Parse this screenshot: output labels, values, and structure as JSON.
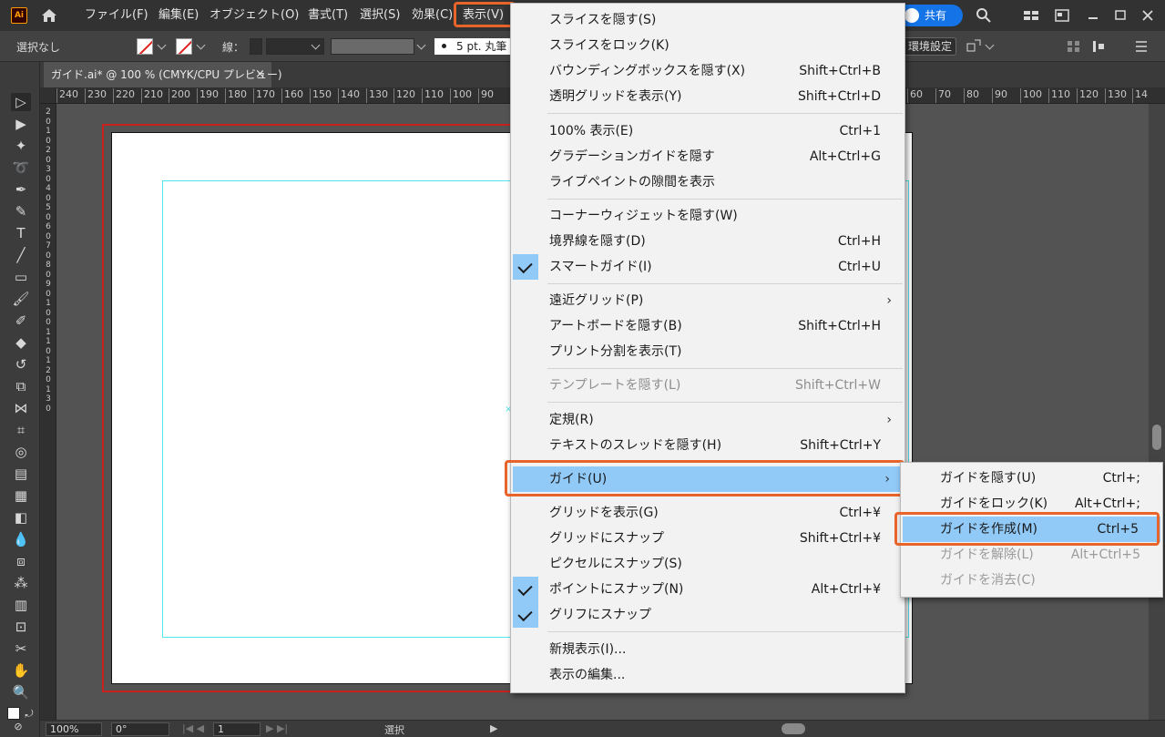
{
  "colors": {
    "accent_highlight": "#e8642a",
    "menu_hover": "#91c9f7",
    "guide": "#52e7ee",
    "artboard_border": "#c8201c",
    "share_blue": "#1473e6"
  },
  "app": {
    "logo": "Ai"
  },
  "menubar": {
    "items": [
      "ファイル(F)",
      "編集(E)",
      "オブジェクト(O)",
      "書式(T)",
      "選択(S)",
      "効果(C)",
      "表示(V)"
    ],
    "active": "表示(V)",
    "share_label": "共有"
  },
  "control": {
    "selection": "選択なし",
    "stroke_label": "線：",
    "brush": "5 pt. 丸筆",
    "env_settings": "環境設定"
  },
  "document": {
    "tab_title": "ガイド.ai* @ 100 % (CMYK/CPU プレビュー)",
    "close": "×"
  },
  "ruler": {
    "h_ticks": [
      "240",
      "230",
      "220",
      "210",
      "200",
      "190",
      "180",
      "170",
      "160",
      "150",
      "140",
      "130",
      "120",
      "110",
      "100",
      "90",
      "60",
      "70",
      "80",
      "90",
      "100",
      "110",
      "120",
      "130",
      "14"
    ],
    "v_ticks": [
      "2",
      "0",
      "1",
      "0",
      "2",
      "0",
      "3",
      "0",
      "4",
      "0",
      "5",
      "0",
      "6",
      "0",
      "7",
      "0",
      "8",
      "0",
      "9",
      "0",
      "1",
      "0",
      "0",
      "1",
      "1",
      "0",
      "1",
      "2",
      "0",
      "1",
      "3",
      "0"
    ]
  },
  "status": {
    "zoom": "100%",
    "rotation": "0°",
    "page": "1",
    "tool": "選択"
  },
  "view_menu": {
    "items": [
      {
        "label": "スライスを隠す(S)",
        "shortcut": ""
      },
      {
        "label": "スライスをロック(K)",
        "shortcut": ""
      },
      {
        "label": "バウンディングボックスを隠す(X)",
        "shortcut": "Shift+Ctrl+B"
      },
      {
        "label": "透明グリッドを表示(Y)",
        "shortcut": "Shift+Ctrl+D"
      },
      {
        "label": "100% 表示(E)",
        "shortcut": "Ctrl+1"
      },
      {
        "label": "グラデーションガイドを隠す",
        "shortcut": "Alt+Ctrl+G"
      },
      {
        "label": "ライブペイントの隙間を表示",
        "shortcut": ""
      },
      {
        "label": "コーナーウィジェットを隠す(W)",
        "shortcut": ""
      },
      {
        "label": "境界線を隠す(D)",
        "shortcut": "Ctrl+H"
      },
      {
        "label": "スマートガイド(I)",
        "shortcut": "Ctrl+U"
      },
      {
        "label": "遠近グリッド(P)",
        "shortcut": ""
      },
      {
        "label": "アートボードを隠す(B)",
        "shortcut": "Shift+Ctrl+H"
      },
      {
        "label": "プリント分割を表示(T)",
        "shortcut": ""
      },
      {
        "label": "テンプレートを隠す(L)",
        "shortcut": "Shift+Ctrl+W"
      },
      {
        "label": "定規(R)",
        "shortcut": ""
      },
      {
        "label": "テキストのスレッドを隠す(H)",
        "shortcut": "Shift+Ctrl+Y"
      },
      {
        "label": "ガイド(U)",
        "shortcut": ""
      },
      {
        "label": "グリッドを表示(G)",
        "shortcut": "Ctrl+¥"
      },
      {
        "label": "グリッドにスナップ",
        "shortcut": "Shift+Ctrl+¥"
      },
      {
        "label": "ピクセルにスナップ(S)",
        "shortcut": ""
      },
      {
        "label": "ポイントにスナップ(N)",
        "shortcut": "Alt+Ctrl+¥"
      },
      {
        "label": "グリフにスナップ",
        "shortcut": ""
      },
      {
        "label": "新規表示(I)...",
        "shortcut": ""
      },
      {
        "label": "表示の編集...",
        "shortcut": ""
      }
    ],
    "submenu_arrow": "›"
  },
  "guide_submenu": {
    "items": [
      {
        "label": "ガイドを隠す(U)",
        "shortcut": "Ctrl+;"
      },
      {
        "label": "ガイドをロック(K)",
        "shortcut": "Alt+Ctrl+;"
      },
      {
        "label": "ガイドを作成(M)",
        "shortcut": "Ctrl+5"
      },
      {
        "label": "ガイドを解除(L)",
        "shortcut": "Alt+Ctrl+5"
      },
      {
        "label": "ガイドを消去(C)",
        "shortcut": ""
      }
    ]
  }
}
